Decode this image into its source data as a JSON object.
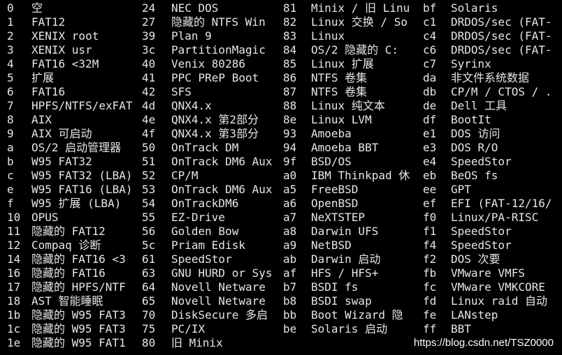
{
  "columns": [
    {
      "rows": [
        {
          "code": "0",
          "name": "空"
        },
        {
          "code": "1",
          "name": "FAT12"
        },
        {
          "code": "2",
          "name": "XENIX root"
        },
        {
          "code": "3",
          "name": "XENIX usr"
        },
        {
          "code": "4",
          "name": "FAT16 <32M"
        },
        {
          "code": "5",
          "name": "扩展"
        },
        {
          "code": "6",
          "name": "FAT16"
        },
        {
          "code": "7",
          "name": "HPFS/NTFS/exFAT"
        },
        {
          "code": "8",
          "name": "AIX"
        },
        {
          "code": "9",
          "name": "AIX 可启动"
        },
        {
          "code": "a",
          "name": "OS/2 启动管理器"
        },
        {
          "code": "b",
          "name": "W95 FAT32"
        },
        {
          "code": "c",
          "name": "W95 FAT32 (LBA)"
        },
        {
          "code": "e",
          "name": "W95 FAT16 (LBA)"
        },
        {
          "code": "f",
          "name": "W95 扩展 (LBA)"
        },
        {
          "code": "10",
          "name": "OPUS"
        },
        {
          "code": "11",
          "name": "隐藏的 FAT12"
        },
        {
          "code": "12",
          "name": "Compaq 诊断"
        },
        {
          "code": "14",
          "name": "隐藏的 FAT16 <3"
        },
        {
          "code": "16",
          "name": "隐藏的 FAT16"
        },
        {
          "code": "17",
          "name": "隐藏的 HPFS/NTF"
        },
        {
          "code": "18",
          "name": "AST 智能睡眠"
        },
        {
          "code": "1b",
          "name": "隐藏的 W95 FAT3"
        },
        {
          "code": "1c",
          "name": "隐藏的 W95 FAT3"
        },
        {
          "code": "1e",
          "name": "隐藏的 W95 FAT1"
        }
      ]
    },
    {
      "rows": [
        {
          "code": "24",
          "name": "NEC DOS"
        },
        {
          "code": "27",
          "name": "隐藏的 NTFS Win"
        },
        {
          "code": "39",
          "name": "Plan 9"
        },
        {
          "code": "3c",
          "name": "PartitionMagic"
        },
        {
          "code": "40",
          "name": "Venix 80286"
        },
        {
          "code": "41",
          "name": "PPC PReP Boot"
        },
        {
          "code": "42",
          "name": "SFS"
        },
        {
          "code": "4d",
          "name": "QNX4.x"
        },
        {
          "code": "4e",
          "name": "QNX4.x 第2部分"
        },
        {
          "code": "4f",
          "name": "QNX4.x 第3部分"
        },
        {
          "code": "50",
          "name": "OnTrack DM"
        },
        {
          "code": "51",
          "name": "OnTrack DM6 Aux"
        },
        {
          "code": "52",
          "name": "CP/M"
        },
        {
          "code": "53",
          "name": "OnTrack DM6 Aux"
        },
        {
          "code": "54",
          "name": "OnTrackDM6"
        },
        {
          "code": "55",
          "name": "EZ-Drive"
        },
        {
          "code": "56",
          "name": "Golden Bow"
        },
        {
          "code": "5c",
          "name": "Priam Edisk"
        },
        {
          "code": "61",
          "name": "SpeedStor"
        },
        {
          "code": "63",
          "name": "GNU HURD or Sys"
        },
        {
          "code": "64",
          "name": "Novell Netware"
        },
        {
          "code": "65",
          "name": "Novell Netware"
        },
        {
          "code": "70",
          "name": "DiskSecure 多启"
        },
        {
          "code": "75",
          "name": "PC/IX"
        },
        {
          "code": "80",
          "name": "旧 Minix"
        }
      ]
    },
    {
      "rows": [
        {
          "code": "81",
          "name": "Minix / 旧 Linu"
        },
        {
          "code": "82",
          "name": "Linux 交换 / So"
        },
        {
          "code": "83",
          "name": "Linux"
        },
        {
          "code": "84",
          "name": "OS/2 隐藏的 C:"
        },
        {
          "code": "85",
          "name": "Linux 扩展"
        },
        {
          "code": "86",
          "name": "NTFS 卷集"
        },
        {
          "code": "87",
          "name": "NTFS 卷集"
        },
        {
          "code": "88",
          "name": "Linux 纯文本"
        },
        {
          "code": "8e",
          "name": "Linux LVM"
        },
        {
          "code": "93",
          "name": "Amoeba"
        },
        {
          "code": "94",
          "name": "Amoeba BBT"
        },
        {
          "code": "9f",
          "name": "BSD/OS"
        },
        {
          "code": "a0",
          "name": "IBM Thinkpad 休"
        },
        {
          "code": "a5",
          "name": "FreeBSD"
        },
        {
          "code": "a6",
          "name": "OpenBSD"
        },
        {
          "code": "a7",
          "name": "NeXTSTEP"
        },
        {
          "code": "a8",
          "name": "Darwin UFS"
        },
        {
          "code": "a9",
          "name": "NetBSD"
        },
        {
          "code": "ab",
          "name": "Darwin 启动"
        },
        {
          "code": "af",
          "name": "HFS / HFS+"
        },
        {
          "code": "b7",
          "name": "BSDI fs"
        },
        {
          "code": "b8",
          "name": "BSDI swap"
        },
        {
          "code": "bb",
          "name": "Boot Wizard 隐"
        },
        {
          "code": "be",
          "name": "Solaris 启动"
        },
        {
          "code": "",
          "name": ""
        }
      ]
    },
    {
      "rows": [
        {
          "code": "bf",
          "name": "Solaris"
        },
        {
          "code": "c1",
          "name": "DRDOS/sec (FAT-"
        },
        {
          "code": "c4",
          "name": "DRDOS/sec (FAT-"
        },
        {
          "code": "c6",
          "name": "DRDOS/sec (FAT-"
        },
        {
          "code": "c7",
          "name": "Syrinx"
        },
        {
          "code": "da",
          "name": "非文件系统数据"
        },
        {
          "code": "db",
          "name": "CP/M / CTOS / ."
        },
        {
          "code": "de",
          "name": "Dell 工具"
        },
        {
          "code": "df",
          "name": "BootIt"
        },
        {
          "code": "e1",
          "name": "DOS 访问"
        },
        {
          "code": "e3",
          "name": "DOS R/O"
        },
        {
          "code": "e4",
          "name": "SpeedStor"
        },
        {
          "code": "eb",
          "name": "BeOS fs"
        },
        {
          "code": "ee",
          "name": "GPT"
        },
        {
          "code": "ef",
          "name": "EFI (FAT-12/16/"
        },
        {
          "code": "f0",
          "name": "Linux/PA-RISC"
        },
        {
          "code": "f1",
          "name": "SpeedStor"
        },
        {
          "code": "f4",
          "name": "SpeedStor"
        },
        {
          "code": "f2",
          "name": "DOS 次要"
        },
        {
          "code": "fb",
          "name": "VMware VMFS"
        },
        {
          "code": "fc",
          "name": "VMware VMKCORE"
        },
        {
          "code": "fd",
          "name": "Linux raid 自动"
        },
        {
          "code": "fe",
          "name": "LANstep"
        },
        {
          "code": "ff",
          "name": "BBT"
        },
        {
          "code": "",
          "name": ""
        }
      ]
    }
  ],
  "watermark": "https://blog.csdn.net/TSZ0000"
}
